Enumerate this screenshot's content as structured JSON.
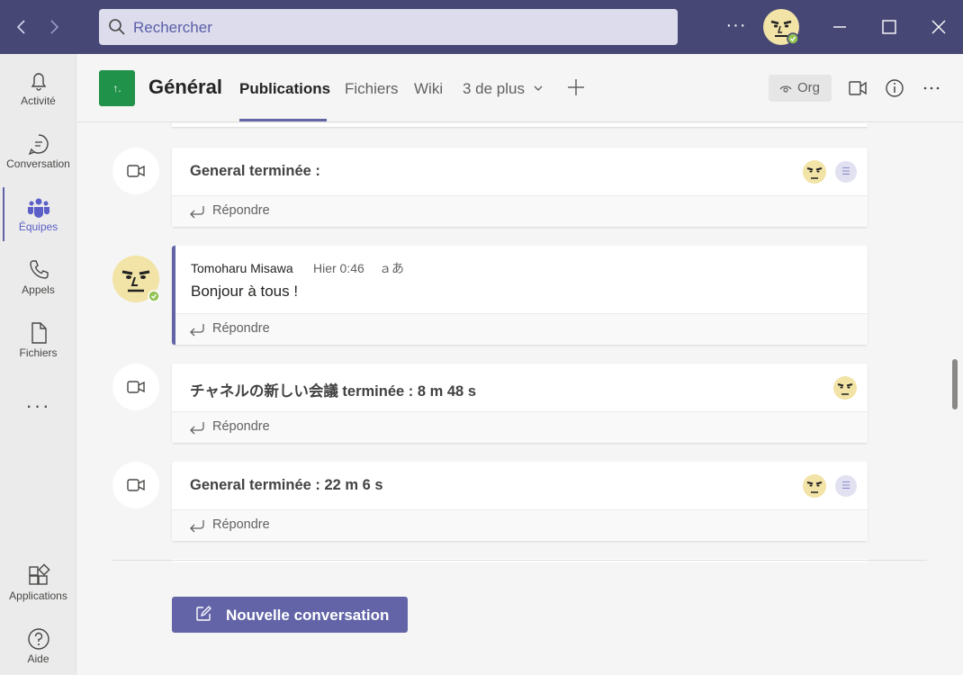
{
  "titlebar": {
    "search_placeholder": "Rechercher",
    "more": "···"
  },
  "rail": {
    "items": [
      {
        "label": "Activité",
        "icon": "bell-icon"
      },
      {
        "label": "Conversation",
        "icon": "chat-icon"
      },
      {
        "label": "Équipes",
        "icon": "teams-icon"
      },
      {
        "label": "Appels",
        "icon": "phone-icon"
      },
      {
        "label": "Fichiers",
        "icon": "file-icon"
      }
    ],
    "more": "···",
    "bottom": [
      {
        "label": "Applications",
        "icon": "apps-icon"
      },
      {
        "label": "Aide",
        "icon": "help-icon"
      }
    ]
  },
  "header": {
    "channel_name": "Général",
    "tabs": [
      {
        "label": "Publications"
      },
      {
        "label": "Fichiers"
      },
      {
        "label": "Wiki"
      }
    ],
    "more_tabs": "3 de plus",
    "org_label": "Org"
  },
  "feed": {
    "reply_label": "Répondre",
    "meetings": [
      {
        "title": "General terminée :"
      },
      {
        "title": "チャネルの新しい会議 terminée : 8 m 48 s"
      },
      {
        "title": "General terminée : 22 m 6 s"
      }
    ],
    "message": {
      "author": "Tomoharu Misawa",
      "time": "Hier 0:46",
      "translate": "ａあ",
      "body": "Bonjour à tous !"
    },
    "new_conversation": "Nouvelle conversation"
  },
  "colors": {
    "titlebar": "#464775",
    "accent": "#6264a7",
    "team_icon": "#21924a"
  }
}
